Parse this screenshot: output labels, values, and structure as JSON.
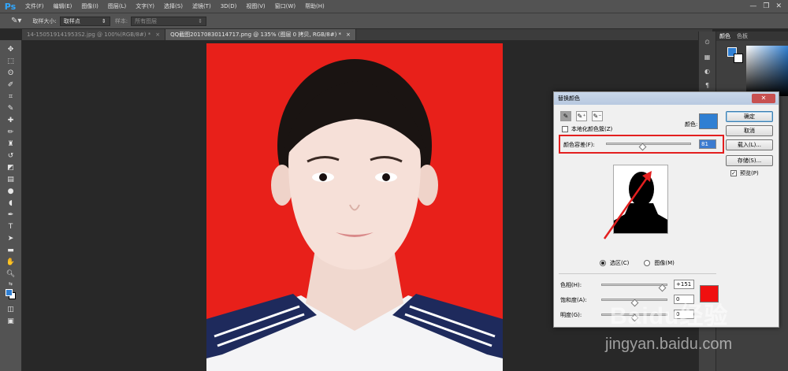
{
  "app": {
    "logo": "Ps"
  },
  "menu": [
    "文件(F)",
    "编辑(E)",
    "图像(I)",
    "图层(L)",
    "文字(Y)",
    "选择(S)",
    "滤镜(T)",
    "3D(D)",
    "视图(V)",
    "窗口(W)",
    "帮助(H)"
  ],
  "options": {
    "sample_size_label": "取样大小:",
    "sample_size_value": "取样点",
    "sample_label": "样本:",
    "sample_value": "所有图层"
  },
  "tabs": [
    {
      "label": "14-150519141953S2.jpg @ 100%(RGB/8#) *",
      "close": "×"
    },
    {
      "label": "QQ截图20170830114717.png @ 135% (图层 0 拷贝, RGB/8#) *",
      "close": "×"
    }
  ],
  "right_panel": {
    "tabs": [
      "颜色",
      "色板"
    ]
  },
  "dialog": {
    "title": "替换颜色",
    "close": "✕",
    "localized_label": "本地化颜色簇(Z)",
    "color_label": "颜色:",
    "tolerance_label": "颜色容差(F):",
    "tolerance_value": "81",
    "radio_selection": "选区(C)",
    "radio_image": "图像(M)",
    "hue_label": "色相(H):",
    "hue_value": "+151",
    "saturation_label": "饱和度(A):",
    "saturation_value": "0",
    "lightness_label": "明度(G):",
    "lightness_value": "0",
    "buttons": {
      "ok": "确定",
      "cancel": "取消",
      "load": "载入(L)...",
      "save": "存储(S)..."
    },
    "preview_label": "预览(P)",
    "preview_checked": true,
    "colors": {
      "sample": "#2f7fd3",
      "result": "#f01010"
    }
  },
  "watermark": {
    "brand": "Baidu经验",
    "url": "jingyan.baidu.com"
  }
}
